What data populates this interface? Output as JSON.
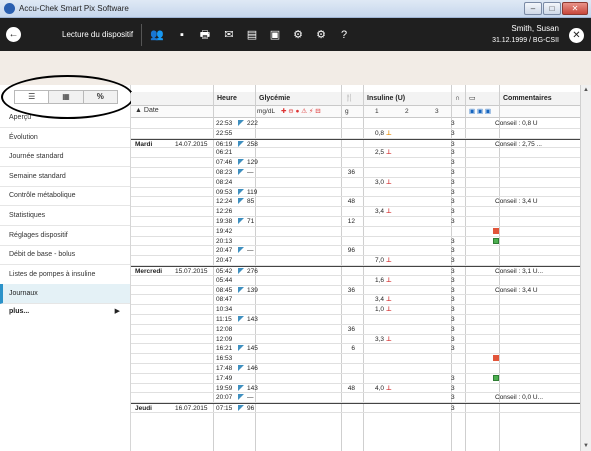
{
  "window": {
    "title": "Accu-Chek Smart Pix Software"
  },
  "toolbar": {
    "title": "Lecture du dispositif",
    "patient_name": "Smith, Susan",
    "patient_info": "31.12.1999 / BG-CSII"
  },
  "view_switch": {
    "percent_label": "%"
  },
  "sidebar": {
    "items": [
      "Aperçu",
      "Évolution",
      "Journée standard",
      "Semaine standard",
      "Contrôle métabolique",
      "Statistiques",
      "Réglages dispositif",
      "Débit de base - bolus",
      "Listes de pompes à insuline",
      "Journaux"
    ],
    "active_index": 9,
    "more_label": "plus..."
  },
  "table": {
    "date_header": "Date",
    "headers": {
      "heure": "Heure",
      "glycemie": "Glycémie",
      "insuline": "Insuline (U)",
      "commentaires": "Commentaires"
    },
    "sub": {
      "glyc_unit": "mg/dL",
      "meal_unit": "g",
      "ins_1": "1",
      "ins_2": "2",
      "ins_3": "3"
    },
    "rows": [
      {
        "time": "22:53",
        "glyc": "222",
        "ins": "",
        "bas": "3",
        "comm": "Conseil : 0,8 U"
      },
      {
        "time": "22:55",
        "glyc": "",
        "ins": "0,8",
        "bas": "3",
        "comm": ""
      },
      {
        "day": "Mardi",
        "date": "14.07.2015",
        "time": "06:19",
        "glyc": "258",
        "ins": "",
        "bas": "3",
        "comm": "Conseil : 2,75 ..."
      },
      {
        "time": "06:21",
        "glyc": "",
        "ins": "2,5",
        "bas": "3",
        "comm": ""
      },
      {
        "time": "07:46",
        "glyc": "129",
        "ins": "",
        "bas": "3",
        "comm": ""
      },
      {
        "time": "08:23",
        "glyc": "—",
        "meal": "36",
        "ins": "",
        "bas": "3",
        "comm": ""
      },
      {
        "time": "08:24",
        "glyc": "",
        "ins": "3,0",
        "bas": "3",
        "comm": ""
      },
      {
        "time": "09:53",
        "glyc": "119",
        "ins": "",
        "bas": "3",
        "comm": ""
      },
      {
        "time": "12:24",
        "glyc": "85",
        "meal": "48",
        "ins": "",
        "bas": "3",
        "comm": "Conseil : 3,4 U"
      },
      {
        "time": "12:26",
        "glyc": "",
        "ins": "3,4",
        "bas": "3",
        "comm": ""
      },
      {
        "time": "19:38",
        "glyc": "71",
        "meal": "12",
        "ins": "",
        "bas": "3",
        "comm": ""
      },
      {
        "time": "19:42",
        "glyc": "",
        "ins": "",
        "bas": "",
        "comm": ""
      },
      {
        "time": "20:13",
        "glyc": "",
        "ins": "",
        "bas": "3",
        "comm": ""
      },
      {
        "time": "20:47",
        "glyc": "—",
        "meal": "96",
        "ins": "",
        "bas": "3",
        "comm": ""
      },
      {
        "time": "20:47",
        "glyc": "",
        "ins": "7,0",
        "bas": "3",
        "comm": ""
      },
      {
        "day": "Mercredi",
        "date": "15.07.2015",
        "time": "05:42",
        "glyc": "276",
        "ins": "",
        "bas": "3",
        "comm": "Conseil : 3,1 U..."
      },
      {
        "time": "05:44",
        "glyc": "",
        "ins": "1,6",
        "bas": "3",
        "comm": ""
      },
      {
        "time": "08:45",
        "glyc": "139",
        "meal": "36",
        "ins": "",
        "bas": "3",
        "comm": "Conseil : 3,4 U"
      },
      {
        "time": "08:47",
        "glyc": "",
        "ins": "3,4",
        "bas": "3",
        "comm": ""
      },
      {
        "time": "10:34",
        "glyc": "",
        "ins": "1,0",
        "bas": "3",
        "comm": ""
      },
      {
        "time": "11:15",
        "glyc": "143",
        "ins": "",
        "bas": "3",
        "comm": ""
      },
      {
        "time": "12:08",
        "glyc": "",
        "meal": "36",
        "ins": "",
        "bas": "3",
        "comm": ""
      },
      {
        "time": "12:09",
        "glyc": "",
        "ins": "3,3",
        "bas": "3",
        "comm": ""
      },
      {
        "time": "16:21",
        "glyc": "145",
        "meal": "6",
        "ins": "",
        "bas": "3",
        "comm": ""
      },
      {
        "time": "16:53",
        "glyc": "",
        "ins": "",
        "bas": "",
        "comm": ""
      },
      {
        "time": "17:48",
        "glyc": "146",
        "ins": "",
        "bas": "",
        "comm": ""
      },
      {
        "time": "17:49",
        "glyc": "",
        "ins": "",
        "bas": "3",
        "comm": ""
      },
      {
        "time": "19:59",
        "glyc": "143",
        "meal": "48",
        "ins": "4,0",
        "bas": "3",
        "comm": ""
      },
      {
        "time": "20:07",
        "glyc": "—",
        "ins": "",
        "bas": "3",
        "comm": "Conseil : 0,0 U..."
      },
      {
        "day": "Jeudi",
        "date": "16.07.2015",
        "time": "07:15",
        "glyc": "96",
        "ins": "",
        "bas": "3",
        "comm": ""
      }
    ]
  }
}
